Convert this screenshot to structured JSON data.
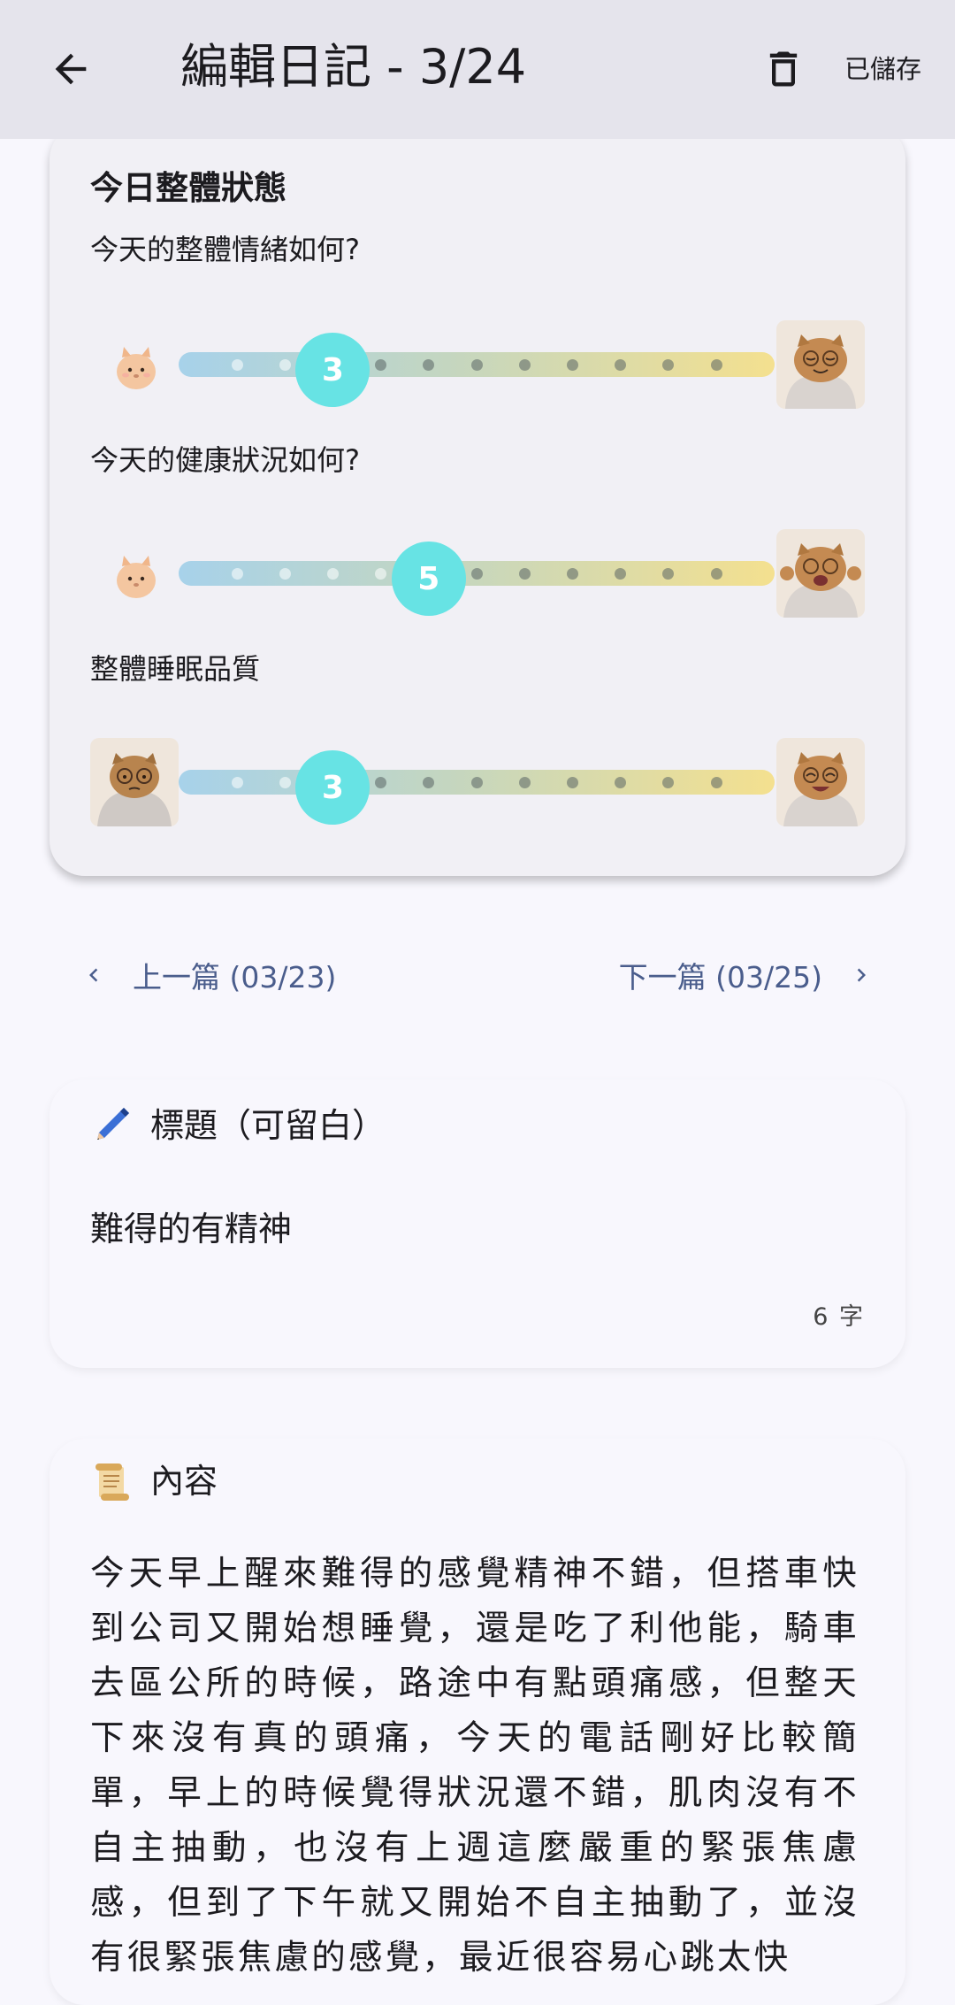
{
  "appbar": {
    "title": "編輯日記 - 3/24",
    "saved_label": "已儲存"
  },
  "overall": {
    "section_title": "今日整體狀態",
    "mood": {
      "question": "今天的整體情緒如何?",
      "value": "3",
      "level": 3,
      "steps": 11
    },
    "health": {
      "question": "今天的健康狀況如何?",
      "value": "5",
      "level": 5,
      "steps": 11
    },
    "sleep": {
      "question": "整體睡眠品質",
      "value": "3",
      "level": 3,
      "steps": 11
    }
  },
  "nav": {
    "prev_label": "上一篇 (03/23)",
    "next_label": "下一篇 (03/25)"
  },
  "title_card": {
    "heading": "標題（可留白）",
    "value": "難得的有精神",
    "char_count": "6 字"
  },
  "content_card": {
    "heading": "內容",
    "text": "今天早上醒來難得的感覺精神不錯，但搭車快到公司又開始想睡覺，還是吃了利他能，騎車去區公所的時候，路途中有點頭痛感，但整天下來沒有真的頭痛，今天的電話剛好比較簡單，早上的時候覺得狀況還不錯，肌肉沒有不自主抽動，也沒有上週這麼嚴重的緊張焦慮感，但到了下午就又開始不自主抽動了，並沒有很緊張焦慮的感覺，最近很容易心跳太快"
  },
  "colors": {
    "appbar_bg": "#e5e4ec",
    "thumb": "#67e3e4",
    "link": "#4a5d8c"
  }
}
